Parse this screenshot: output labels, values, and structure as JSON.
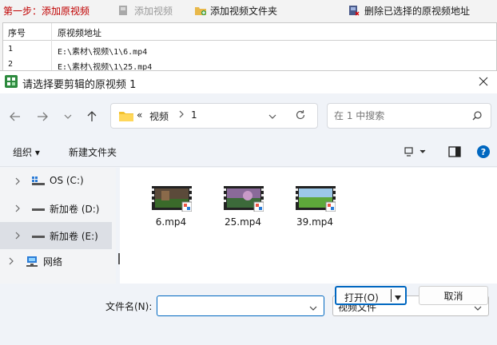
{
  "app": {
    "step_label": "第一步：添加原视频",
    "add_video": "添加视频",
    "add_folder": "添加视频文件夹",
    "delete_selected": "删除已选择的原视频地址",
    "table": {
      "col_index": "序号",
      "col_path": "原视频地址",
      "rows": [
        {
          "index": "1",
          "path": "E:\\素材\\视频\\1\\6.mp4"
        },
        {
          "index": "2",
          "path": "E:\\素材\\视频\\1\\25.mp4"
        }
      ]
    }
  },
  "dialog": {
    "title": "请选择要剪辑的原视频 1",
    "breadcrumb": {
      "overflow": "«",
      "parts": [
        "视频",
        "1"
      ]
    },
    "search_placeholder": "在 1 中搜索",
    "organize": "组织 ▾",
    "new_folder": "新建文件夹",
    "nav": [
      {
        "label": "OS (C:)"
      },
      {
        "label": "新加卷 (D:)"
      },
      {
        "label": "新加卷 (E:)",
        "selected": true
      },
      {
        "label": "网络"
      }
    ],
    "files": [
      {
        "name": "6.mp4"
      },
      {
        "name": "25.mp4"
      },
      {
        "name": "39.mp4"
      }
    ],
    "filename_label": "文件名(N):",
    "filename_value": "",
    "filetype": "视频文件",
    "open_button": "打开(O)",
    "cancel_button": "取消"
  },
  "colors": {
    "accent": "#0067c0",
    "step_label": "#c00000"
  }
}
